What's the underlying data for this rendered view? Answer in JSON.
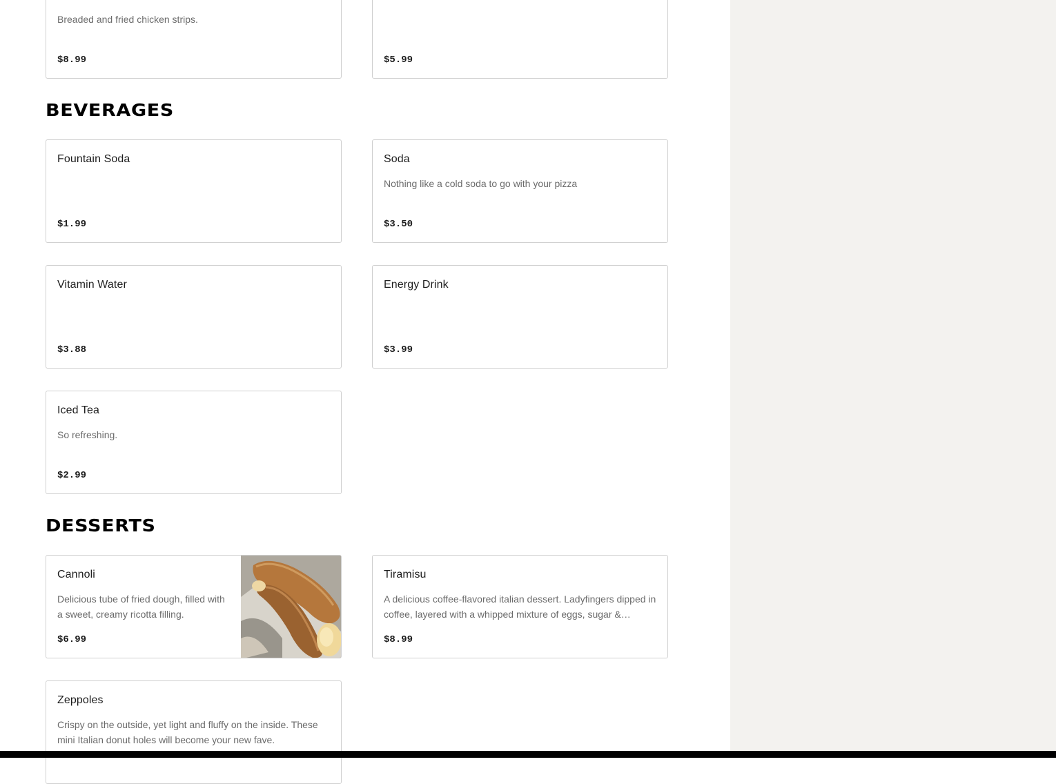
{
  "previous_section": {
    "items": [
      {
        "name": "",
        "description": "Breaded and fried chicken strips.",
        "price": "$8.99"
      },
      {
        "name": "",
        "description": "",
        "price": "$5.99"
      }
    ]
  },
  "sections": [
    {
      "title": "BEVERAGES",
      "items": [
        {
          "name": "Fountain Soda",
          "description": "",
          "price": "$1.99"
        },
        {
          "name": "Soda",
          "description": "Nothing like a cold soda to go with your pizza",
          "price": "$3.50"
        },
        {
          "name": "Vitamin Water",
          "description": "",
          "price": "$3.88"
        },
        {
          "name": "Energy Drink",
          "description": "",
          "price": "$3.99"
        },
        {
          "name": "Iced Tea",
          "description": "So refreshing.",
          "price": "$2.99"
        }
      ]
    },
    {
      "title": "DESSERTS",
      "items": [
        {
          "name": "Cannoli",
          "description": "Delicious tube of fried dough, filled with a sweet, creamy ricotta filling.",
          "price": "$6.99",
          "photo": "cannoli-photo"
        },
        {
          "name": "Tiramisu",
          "description": "A delicious coffee-flavored italian dessert. Ladyfingers dipped in coffee, layered with a whipped mixture of eggs, sugar &…",
          "price": "$8.99"
        },
        {
          "name": "Zeppoles",
          "description": "Crispy on the outside, yet light and fluffy on the inside. These mini Italian donut holes will become your new fave.",
          "price": ""
        }
      ]
    }
  ],
  "colors": {
    "card_border": "#cfcfcf",
    "description_text": "#6b6b6b",
    "side_panel": "#f3f2ef"
  }
}
